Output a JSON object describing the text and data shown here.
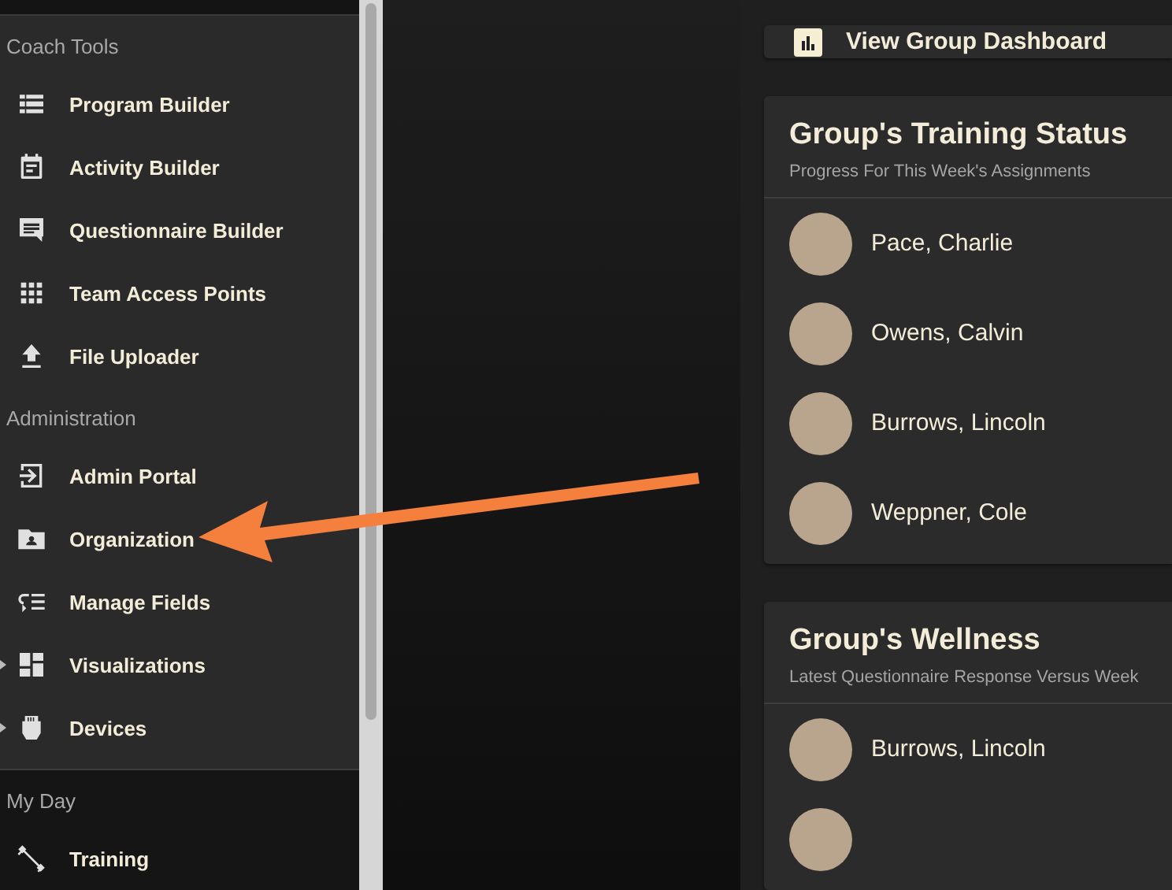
{
  "sidebar": {
    "sections": [
      {
        "title": "Coach Tools",
        "items": [
          {
            "label": "Program Builder",
            "kind": "link"
          },
          {
            "label": "Activity Builder",
            "kind": "link"
          },
          {
            "label": "Questionnaire Builder",
            "kind": "link"
          },
          {
            "label": "Team Access Points",
            "kind": "link"
          },
          {
            "label": "File Uploader",
            "kind": "link"
          }
        ]
      },
      {
        "title": "Administration",
        "items": [
          {
            "label": "Admin Portal",
            "kind": "link"
          },
          {
            "label": "Organization",
            "kind": "link"
          },
          {
            "label": "Manage Fields",
            "kind": "link"
          },
          {
            "label": "Visualizations",
            "kind": "group"
          },
          {
            "label": "Devices",
            "kind": "group"
          }
        ]
      },
      {
        "title": "My Day",
        "items": [
          {
            "label": "Training",
            "kind": "link"
          }
        ]
      }
    ]
  },
  "dashboard_button": {
    "label": "View Group Dashboard"
  },
  "cards": [
    {
      "title": "Group's Training Status",
      "subtitle": "Progress For This Week's Assignments",
      "members": [
        {
          "name": "Pace, Charlie",
          "kind": "full"
        },
        {
          "name": "Owens, Calvin",
          "kind": "full"
        },
        {
          "name": "Burrows, Lincoln",
          "kind": "full"
        },
        {
          "name": "Weppner, Cole",
          "kind": "full"
        }
      ]
    },
    {
      "title": "Group's Wellness",
      "subtitle": "Latest Questionnaire Response Versus Week",
      "members": [
        {
          "name": "Burrows, Lincoln",
          "kind": "full"
        },
        {
          "kind": "cut_off"
        }
      ]
    }
  ]
}
